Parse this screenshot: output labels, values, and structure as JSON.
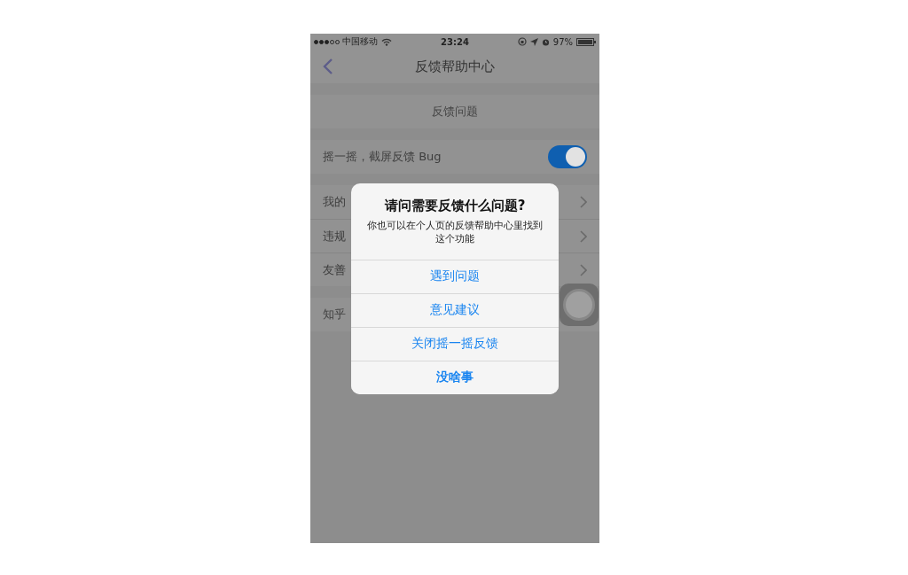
{
  "status_bar": {
    "carrier": "中国移动",
    "time": "23:24",
    "battery": "97%"
  },
  "nav": {
    "title": "反馈帮助中心"
  },
  "sections": [
    {
      "items": [
        {
          "kind": "center",
          "label": "反馈问题"
        }
      ]
    },
    {
      "items": [
        {
          "kind": "toggle",
          "label": "摇一摇，截屏反馈 Bug",
          "on": true
        }
      ]
    },
    {
      "items": [
        {
          "kind": "link",
          "label": "我的"
        },
        {
          "kind": "link",
          "label": "违规"
        },
        {
          "kind": "link",
          "label": "友善"
        }
      ]
    },
    {
      "items": [
        {
          "kind": "link",
          "label": "知乎"
        }
      ]
    }
  ],
  "dialog": {
    "title": "请问需要反馈什么问题?",
    "message": "你也可以在个人页的反馈帮助中心里找到这个功能",
    "actions": [
      {
        "label": "遇到问题",
        "kind": "default"
      },
      {
        "label": "意见建议",
        "kind": "default"
      },
      {
        "label": "关闭摇一摇反馈",
        "kind": "default"
      },
      {
        "label": "没啥事",
        "kind": "cancel"
      }
    ]
  }
}
